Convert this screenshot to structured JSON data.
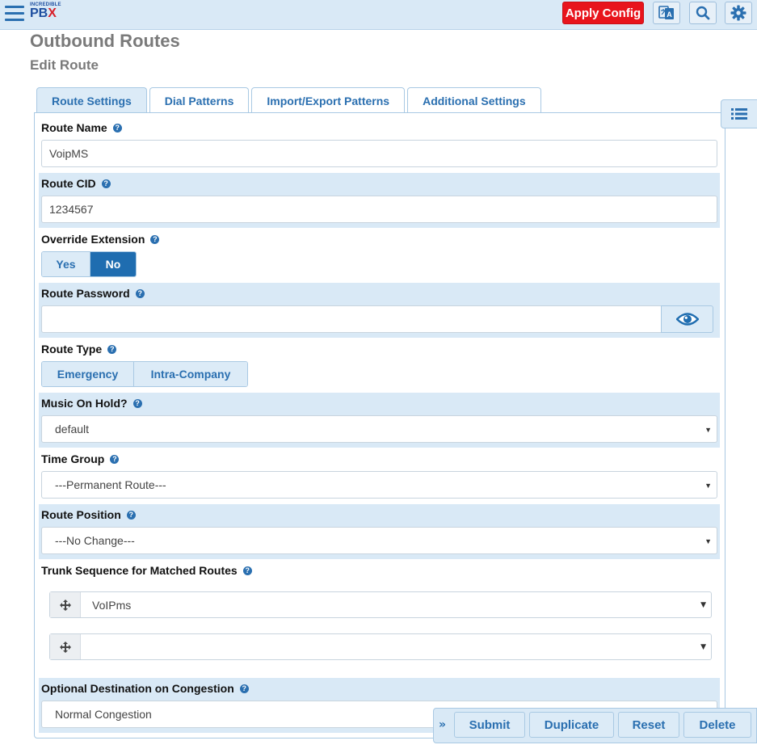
{
  "topbar": {
    "logo_small": "INCREDIBLE",
    "logo_pb": "PB",
    "logo_x": "X",
    "apply_label": "Apply Config",
    "icons": [
      "menu-icon",
      "translate-icon",
      "search-icon",
      "gear-icon"
    ]
  },
  "header": {
    "title": "Outbound Routes",
    "subtitle": "Edit Route"
  },
  "tabs": [
    {
      "label": "Route Settings",
      "active": true
    },
    {
      "label": "Dial Patterns",
      "active": false
    },
    {
      "label": "Import/Export Patterns",
      "active": false
    },
    {
      "label": "Additional Settings",
      "active": false
    }
  ],
  "form": {
    "route_name": {
      "label": "Route Name",
      "value": "VoipMS"
    },
    "route_cid": {
      "label": "Route CID",
      "value": "1234567"
    },
    "override_extension": {
      "label": "Override Extension",
      "options": [
        "Yes",
        "No"
      ],
      "selected": "No"
    },
    "route_password": {
      "label": "Route Password",
      "value": ""
    },
    "route_type": {
      "label": "Route Type",
      "options": [
        "Emergency",
        "Intra-Company"
      ]
    },
    "music_on_hold": {
      "label": "Music On Hold?",
      "value": "default"
    },
    "time_group": {
      "label": "Time Group",
      "value": "---Permanent Route---"
    },
    "route_position": {
      "label": "Route Position",
      "value": "---No Change---"
    },
    "trunk_sequence": {
      "label": "Trunk Sequence for Matched Routes",
      "trunks": [
        "VoIPms",
        ""
      ]
    },
    "congestion": {
      "label": "Optional Destination on Congestion",
      "value": "Normal Congestion"
    }
  },
  "actions": {
    "submit": "Submit",
    "duplicate": "Duplicate",
    "reset": "Reset",
    "delete": "Delete"
  },
  "colors": {
    "accent": "#2a6fb0",
    "apply": "#e8141c",
    "shade": "#d9e9f6"
  }
}
